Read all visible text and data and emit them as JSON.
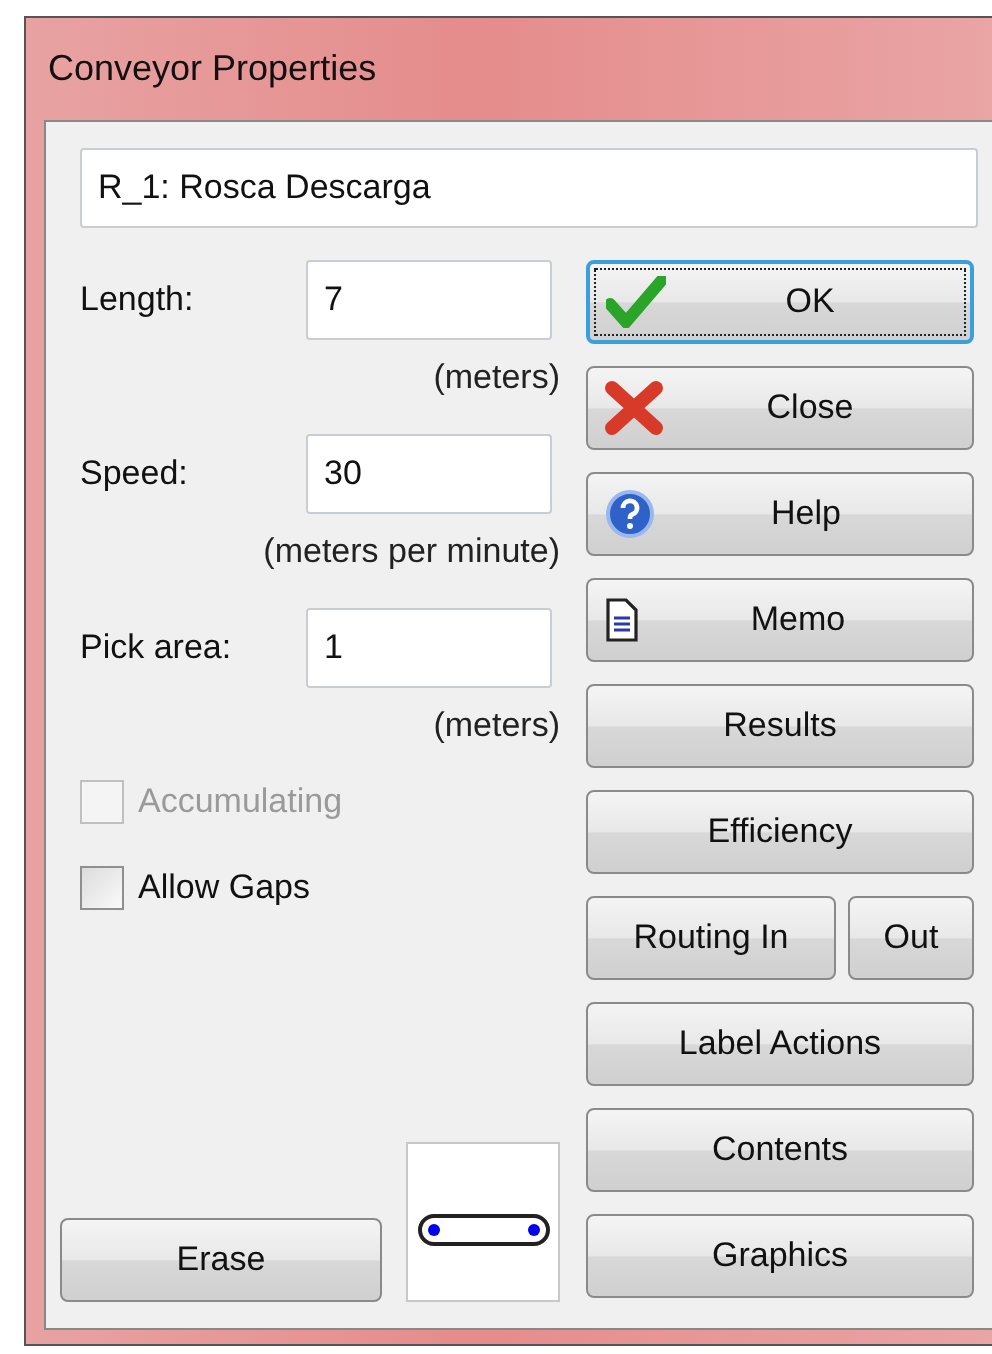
{
  "window": {
    "title": "Conveyor Properties"
  },
  "name_field": {
    "value": "R_1: Rosca Descarga"
  },
  "fields": [
    {
      "label": "Length:",
      "value": "7",
      "unit": "(meters)"
    },
    {
      "label": "Speed:",
      "value": "30",
      "unit": "(meters per minute)"
    },
    {
      "label": "Pick area:",
      "value": "1",
      "unit": "(meters)"
    }
  ],
  "checkboxes": [
    {
      "label": "Accumulating",
      "checked": false,
      "disabled": true
    },
    {
      "label": "Allow Gaps",
      "checked": false,
      "disabled": false
    }
  ],
  "button_rows": [
    [
      {
        "label": "OK",
        "kind": "check",
        "focused": true
      }
    ],
    [
      {
        "label": "Close",
        "kind": "cross",
        "focused": false
      }
    ],
    [
      {
        "label": "Help",
        "kind": "help",
        "focused": false
      }
    ],
    [
      {
        "label": "Memo",
        "kind": "memo",
        "focused": false
      }
    ],
    [
      {
        "label": "Results",
        "focused": false
      }
    ],
    [
      {
        "label": "Efficiency",
        "focused": false
      }
    ],
    [
      {
        "label": "Routing In",
        "focused": false
      },
      {
        "label": "Out",
        "focused": false
      }
    ],
    [
      {
        "label": "Label Actions",
        "focused": false
      }
    ],
    [
      {
        "label": "Contents",
        "focused": false
      }
    ],
    [
      {
        "label": "Graphics",
        "focused": false
      }
    ]
  ],
  "erase_button": {
    "label": "Erase"
  }
}
